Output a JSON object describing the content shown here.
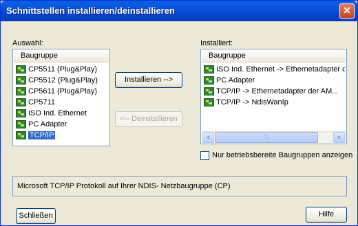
{
  "window": {
    "title": "Schnittstellen installieren/deinstallieren",
    "close_glyph": "✕"
  },
  "left": {
    "label": "Auswahl:",
    "header": "Baugruppe",
    "items": [
      {
        "label": "CP5511 (Plug&Play)",
        "icon": "module-icon",
        "selected": false
      },
      {
        "label": "CP5512 (Plug&Play)",
        "icon": "module-icon",
        "selected": false
      },
      {
        "label": "CP5611 (Plug&Play)",
        "icon": "module-icon",
        "selected": false
      },
      {
        "label": "CP5711",
        "icon": "module-icon",
        "selected": false
      },
      {
        "label": "ISO Ind. Ethernet",
        "icon": "module-icon",
        "selected": false
      },
      {
        "label": "PC Adapter",
        "icon": "module-icon",
        "selected": false
      },
      {
        "label": "TCP/IP",
        "icon": "module-icon",
        "selected": true
      }
    ]
  },
  "buttons": {
    "install": "Installieren -->",
    "uninstall": "<-- Deinstallieren",
    "close": "Schließen",
    "help": "Hilfe"
  },
  "right": {
    "label": "Installiert:",
    "header": "Baugruppe",
    "items": [
      {
        "label": "ISO Ind. Ethernet -> Ethernetadapter der A",
        "icon": "module-icon"
      },
      {
        "label": "PC Adapter",
        "icon": "module-icon"
      },
      {
        "label": "TCP/IP -> Ethernetadapter der AM...",
        "icon": "module-icon"
      },
      {
        "label": "TCP/IP -> NdisWanIp",
        "icon": "module-icon"
      }
    ],
    "scroll_left": "<",
    "scroll_right": ">",
    "scroll_grip": "|||"
  },
  "checkbox": {
    "label": "Nur betriebsbereite Baugruppen anzeigen",
    "checked": false
  },
  "description": "Microsoft TCP/IP Protokoll auf Ihrer NDIS- Netzbaugruppe (CP)"
}
